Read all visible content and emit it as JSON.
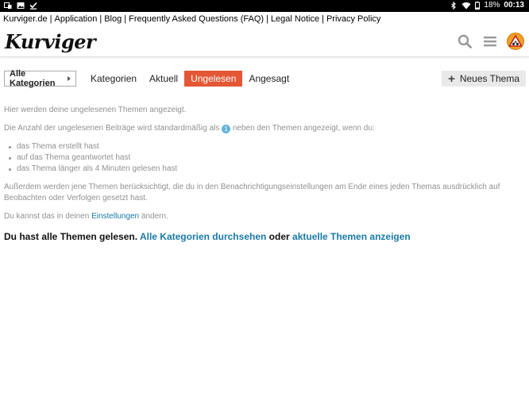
{
  "statusbar": {
    "battery": "18%",
    "time": "00:13"
  },
  "toplinks": [
    "Kurviger.de",
    "Application",
    "Blog",
    "Frequently Asked Questions (FAQ)",
    "Legal Notice",
    "Privacy Policy"
  ],
  "header": {
    "logo_text": "Kurviger"
  },
  "nav": {
    "category_dropdown": "Alle Kategorien",
    "tabs": [
      "Kategorien",
      "Aktuell",
      "Ungelesen",
      "Angesagt"
    ],
    "active_tab": "Ungelesen",
    "new_topic": "Neues Thema"
  },
  "content": {
    "p1": "Hier werden deine ungelesenen Themen angezeigt.",
    "p2_before": "Die Anzahl der ungelesenen Beiträge wird standardmäßig als",
    "p2_badge": "1",
    "p2_after": "neben den Themen angezeigt, wenn du:",
    "list": [
      "das Thema erstellt hast",
      "auf das Thema geantwortet hast",
      "das Thema länger als 4 Minuten gelesen hast"
    ],
    "p3": "Außerdem werden jene Themen berücksichtigt, die du in den Benachrichtigungseinstellungen am Ende eines jeden Themas ausdrücklich auf Beobachten oder Verfolgen gesetzt hast.",
    "p4_before": "Du kannst das in deinen",
    "p4_link": "Einstellungen",
    "p4_after": "ändern."
  },
  "done": {
    "text": "Du hast alle Themen gelesen.",
    "link1": "Alle Kategorien durchsehen",
    "middle": "oder",
    "link2": "aktuelle Themen anzeigen"
  },
  "colors": {
    "accent": "#e45735",
    "link": "#1a79a8",
    "badge": "#62b4d8"
  }
}
